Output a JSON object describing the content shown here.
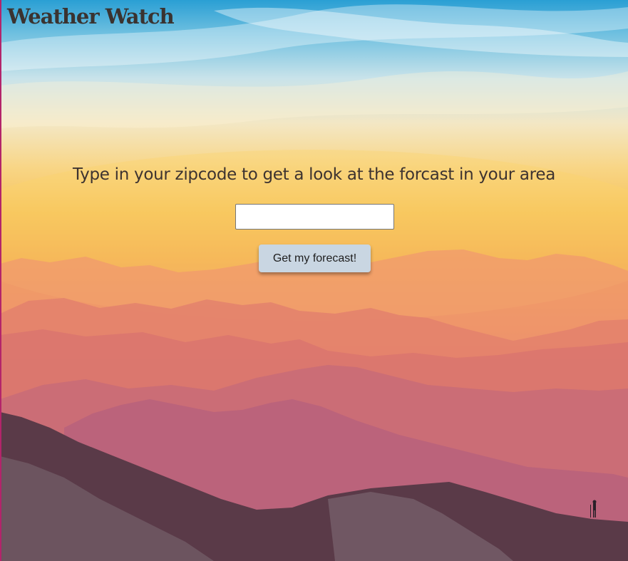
{
  "header": {
    "title": "Weather Watch"
  },
  "main": {
    "prompt": "Type in your zipcode to get a look at the forcast in your area",
    "zip_input": {
      "value": "",
      "placeholder": ""
    },
    "submit_label": "Get my forecast!"
  },
  "theme": {
    "button_bg": "#c9d6e2",
    "text_color": "#3d3330"
  }
}
